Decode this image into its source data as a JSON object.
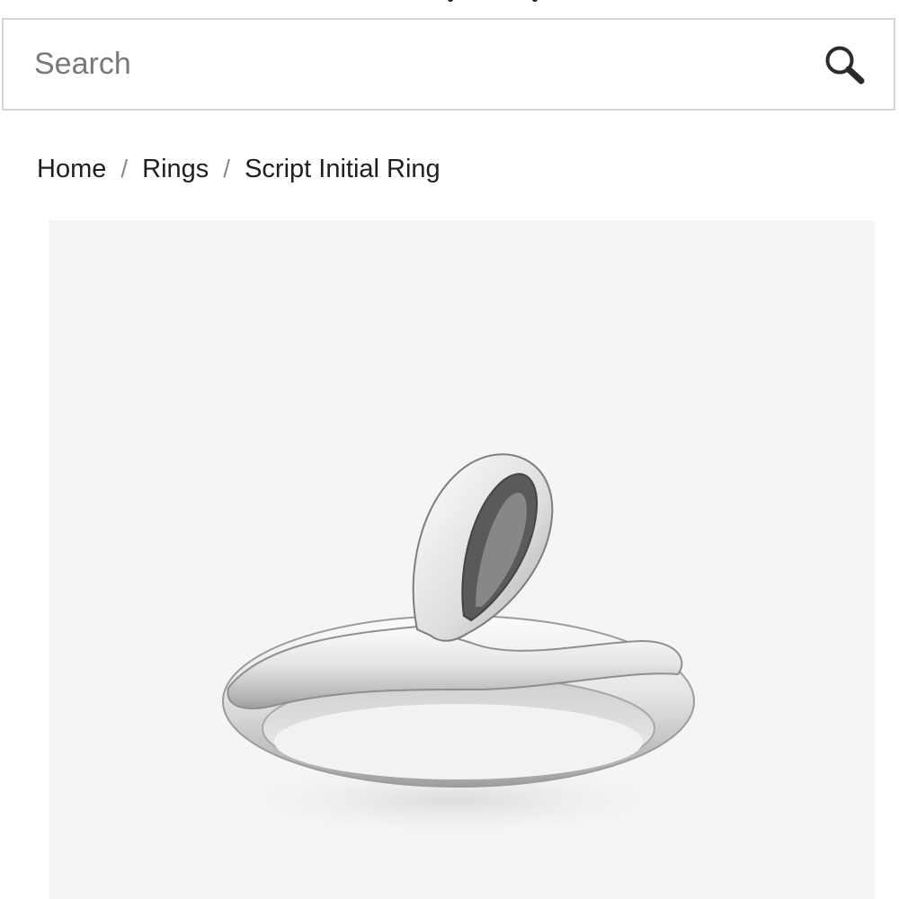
{
  "search": {
    "placeholder": "Search",
    "value": ""
  },
  "breadcrumb": {
    "items": [
      {
        "label": "Home"
      },
      {
        "label": "Rings"
      },
      {
        "label": "Script Initial Ring"
      }
    ],
    "separator": "/"
  },
  "product": {
    "image_alt": "Script Initial Ring",
    "image_background": "#f5f5f5"
  },
  "icons": {
    "search": "search-icon"
  },
  "colors": {
    "border": "#d6d6d6",
    "placeholder": "#77787b",
    "text": "#1f1f1f",
    "image_background": "#f5f5f5"
  }
}
